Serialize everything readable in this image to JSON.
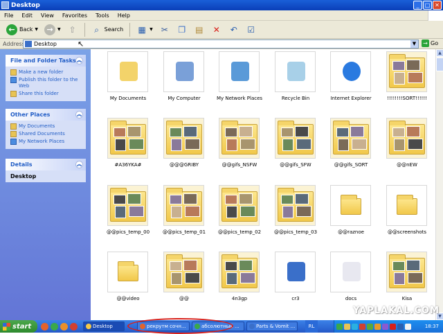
{
  "window": {
    "title": "Desktop"
  },
  "menu": [
    "File",
    "Edit",
    "View",
    "Favorites",
    "Tools",
    "Help"
  ],
  "toolbar": {
    "back_label": "Back",
    "search_label": "Search"
  },
  "address": {
    "label": "Address",
    "value": "Desktop",
    "go_label": "Go"
  },
  "sidebar": {
    "file_tasks": {
      "title": "File and Folder Tasks",
      "items": [
        "Make a new folder",
        "Publish this folder to the Web",
        "Share this folder"
      ]
    },
    "other_places": {
      "title": "Other Places",
      "items": [
        "My Documents",
        "Shared Documents",
        "My Network Places"
      ]
    },
    "details": {
      "title": "Details",
      "value": "Desktop"
    }
  },
  "files": [
    {
      "label": "My Documents",
      "kind": "mydocs-icon"
    },
    {
      "label": "My Computer",
      "kind": "computer-icon"
    },
    {
      "label": "My Network Places",
      "kind": "network-icon"
    },
    {
      "label": "Recycle Bin",
      "kind": "recycle-bin-icon"
    },
    {
      "label": "Internet Explorer",
      "kind": "internet-explorer-icon"
    },
    {
      "label": "!!!!!!!!SORT!!!!!!",
      "kind": "photo-folder"
    },
    {
      "label": "#A36YKA#",
      "kind": "photo-folder"
    },
    {
      "label": "@@@GRIBY",
      "kind": "photo-folder"
    },
    {
      "label": "@@gifs_NSFW",
      "kind": "photo-folder"
    },
    {
      "label": "@@gifs_SFW",
      "kind": "photo-folder"
    },
    {
      "label": "@@gifs_SORT",
      "kind": "photo-folder"
    },
    {
      "label": "@@nEW",
      "kind": "photo-folder"
    },
    {
      "label": "@@pics_temp_00",
      "kind": "photo-folder"
    },
    {
      "label": "@@pics_temp_01",
      "kind": "photo-folder"
    },
    {
      "label": "@@pics_temp_02",
      "kind": "photo-folder"
    },
    {
      "label": "@@pics_temp_03",
      "kind": "photo-folder"
    },
    {
      "label": "@@raznoe",
      "kind": "folder"
    },
    {
      "label": "@@screenshots",
      "kind": "folder"
    },
    {
      "label": "@@video",
      "kind": "folder"
    },
    {
      "label": "@@",
      "kind": "photo-folder"
    },
    {
      "label": "4n3gp",
      "kind": "photo-folder"
    },
    {
      "label": "cr3",
      "kind": "program-icon"
    },
    {
      "label": "docs",
      "kind": "documents-icon"
    },
    {
      "label": "Kisa",
      "kind": "photo-folder"
    }
  ],
  "taskbar": {
    "start_label": "start",
    "buttons": [
      "Desktop",
      "рекрутм сочн...",
      "абсолютный ...",
      "Parts & Vomit ..."
    ],
    "lang": "RL",
    "clock": "18:37"
  },
  "watermark": "YAPLAKAL.COM",
  "colors": {
    "titlebar": "#0a3fb8",
    "sidebar": "#6375d6",
    "taskbar": "#2458c8",
    "highlight_circle": "#d8201a"
  }
}
